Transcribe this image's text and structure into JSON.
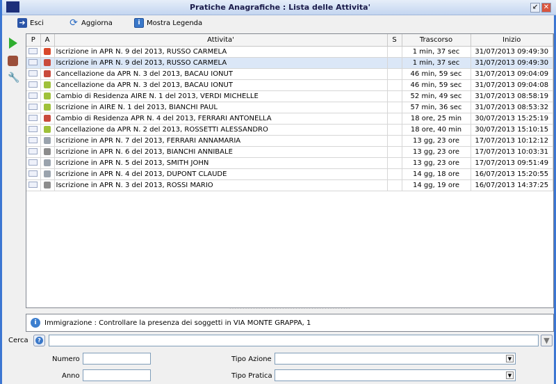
{
  "window": {
    "title": "Pratiche Anagrafiche : Lista delle Attivita'"
  },
  "toolbar": {
    "exit_label": "Esci",
    "refresh_label": "Aggiorna",
    "legend_label": "Mostra Legenda"
  },
  "table": {
    "columns": [
      "P",
      "A",
      "Attivita'",
      "S",
      "Trascorso",
      "Inizio"
    ],
    "rows": [
      {
        "activity": "Iscrizione in APR  N. 9 del 2013, RUSSO CARMELA",
        "elapsed": "1 min, 37 sec",
        "start": "31/07/2013 09:49:30",
        "a_color": "#d9482b"
      },
      {
        "activity": "Iscrizione in APR  N. 9 del 2013, RUSSO CARMELA",
        "elapsed": "1 min, 37 sec",
        "start": "31/07/2013 09:49:30",
        "a_color": "#c94a3c"
      },
      {
        "activity": "Cancellazione da APR  N. 3 del 2013, BACAU IONUT",
        "elapsed": "46 min, 59 sec",
        "start": "31/07/2013 09:04:09",
        "a_color": "#c94a3c"
      },
      {
        "activity": "Cancellazione da APR  N. 3 del 2013, BACAU IONUT",
        "elapsed": "46 min, 59 sec",
        "start": "31/07/2013 09:04:08",
        "a_color": "#9fc13a"
      },
      {
        "activity": "Cambio di Residenza AIRE  N. 1 del 2013, VERDI MICHELLE",
        "elapsed": "52 min, 49 sec",
        "start": "31/07/2013 08:58:19",
        "a_color": "#9fc13a"
      },
      {
        "activity": "Iscrizione in AIRE  N. 1 del 2013, BIANCHI PAUL",
        "elapsed": "57 min, 36 sec",
        "start": "31/07/2013 08:53:32",
        "a_color": "#9fc13a"
      },
      {
        "activity": "Cambio di Residenza APR  N. 4 del 2013, FERRARI ANTONELLA",
        "elapsed": "18 ore, 25 min",
        "start": "30/07/2013 15:25:19",
        "a_color": "#c94a3c"
      },
      {
        "activity": "Cancellazione da APR  N. 2 del 2013, ROSSETTI ALESSANDRO",
        "elapsed": "18 ore, 40 min",
        "start": "30/07/2013 15:10:15",
        "a_color": "#9fc13a"
      },
      {
        "activity": "Iscrizione in APR  N. 7 del 2013, FERRARI ANNAMARIA",
        "elapsed": "13 gg, 23 ore",
        "start": "17/07/2013 10:12:12",
        "a_color": "#9aa3ad"
      },
      {
        "activity": "Iscrizione in APR  N. 6 del 2013, BIANCHI ANNIBALE",
        "elapsed": "13 gg, 23 ore",
        "start": "17/07/2013 10:03:31",
        "a_color": "#8c8c8c"
      },
      {
        "activity": "Iscrizione in APR  N. 5 del 2013, SMITH JOHN",
        "elapsed": "13 gg, 23 ore",
        "start": "17/07/2013 09:51:49",
        "a_color": "#9aa3ad"
      },
      {
        "activity": "Iscrizione in APR  N. 4 del 2013, DUPONT CLAUDE",
        "elapsed": "14 gg, 18 ore",
        "start": "16/07/2013 15:20:55",
        "a_color": "#9aa3ad"
      },
      {
        "activity": "Iscrizione in APR  N. 3 del 2013, ROSSI MARIO",
        "elapsed": "14 gg, 19 ore",
        "start": "16/07/2013 14:37:25",
        "a_color": "#8c8c8c"
      }
    ]
  },
  "info": {
    "message": "Immigrazione : Controllare la presenza dei soggetti in VIA MONTE GRAPPA, 1"
  },
  "search": {
    "label": "Cerca",
    "value": ""
  },
  "filters": {
    "numero_label": "Numero",
    "anno_label": "Anno",
    "tipo_azione_label": "Tipo Azione",
    "tipo_pratica_label": "Tipo Pratica",
    "numero": "",
    "anno": "",
    "tipo_azione": "",
    "tipo_pratica": ""
  }
}
